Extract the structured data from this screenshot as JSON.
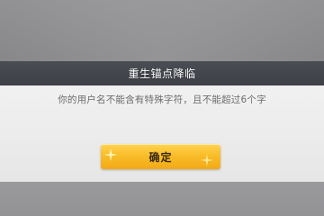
{
  "dialog": {
    "title": "重生锚点降临",
    "message": "你的用户名不能含有特殊字符，且不能超过6个字",
    "confirm_label": "确定"
  },
  "colors": {
    "title_bar": "#3f4248",
    "dialog_bg": "#ececec",
    "message_text": "#6c6c6c",
    "button": "#f7b825",
    "button_text": "#3b2a12"
  },
  "icons": [
    "sparkle-icon",
    "sparkle-icon"
  ]
}
